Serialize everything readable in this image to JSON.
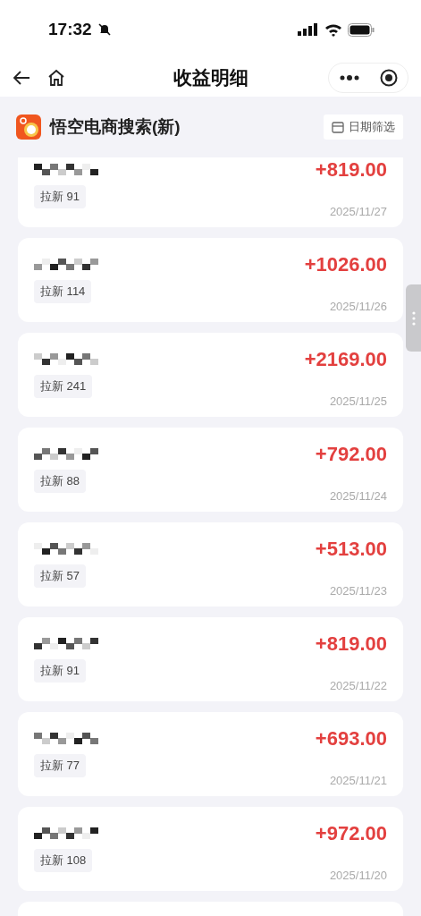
{
  "status_bar": {
    "time": "17:32",
    "silent": true
  },
  "nav": {
    "title": "收益明细"
  },
  "header": {
    "app_name": "悟空电商搜索(新)",
    "filter_label": "日期筛选"
  },
  "records": [
    {
      "tag": "拉新 91",
      "amount": "+819.00",
      "date": "2025/11/27"
    },
    {
      "tag": "拉新 114",
      "amount": "+1026.00",
      "date": "2025/11/26"
    },
    {
      "tag": "拉新 241",
      "amount": "+2169.00",
      "date": "2025/11/25"
    },
    {
      "tag": "拉新 88",
      "amount": "+792.00",
      "date": "2025/11/24"
    },
    {
      "tag": "拉新 57",
      "amount": "+513.00",
      "date": "2025/11/23"
    },
    {
      "tag": "拉新 91",
      "amount": "+819.00",
      "date": "2025/11/22"
    },
    {
      "tag": "拉新 77",
      "amount": "+693.00",
      "date": "2025/11/21"
    },
    {
      "tag": "拉新 108",
      "amount": "+972.00",
      "date": "2025/11/20"
    }
  ]
}
